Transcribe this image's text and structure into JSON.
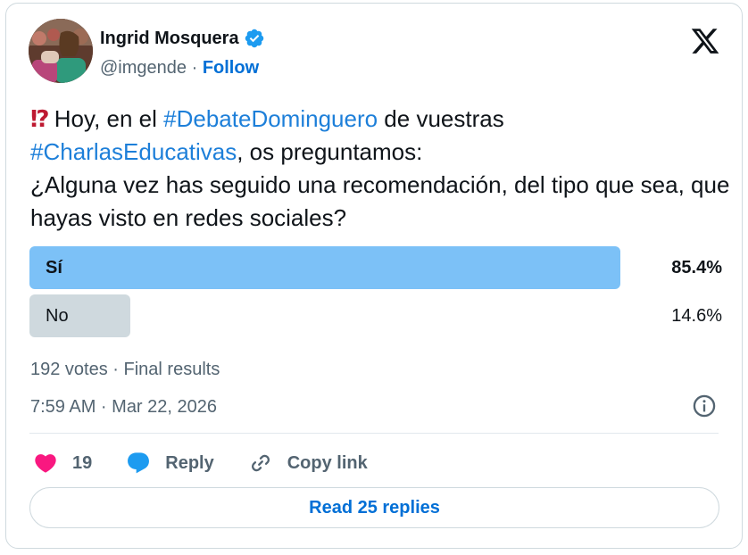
{
  "author": {
    "name": "Ingrid Mosquera",
    "handle": "@imgende",
    "separator": " · ",
    "follow_label": "Follow"
  },
  "tweet": {
    "emoji": "⁉",
    "text_1": " Hoy, en el ",
    "hashtag_1": "#DebateDominguero",
    "text_2": " de vuestras ",
    "hashtag_2": "#CharlasEducativas",
    "text_3": ", os preguntamos:",
    "text_4": "¿Alguna vez has seguido una recomendación, del tipo que sea, que hayas visto en redes sociales?"
  },
  "poll": {
    "options": [
      {
        "label": "Sí",
        "percent_label": "85.4%",
        "percent": 85.4,
        "winner": true
      },
      {
        "label": "No",
        "percent_label": "14.6%",
        "percent": 14.6,
        "winner": false
      }
    ],
    "summary": "192 votes · Final results"
  },
  "timestamp": "7:59 AM · Mar 22, 2026",
  "actions": {
    "like_count": "19",
    "reply_label": "Reply",
    "copy_link_label": "Copy link"
  },
  "read_replies_label": "Read 25 replies",
  "colors": {
    "accent": "#1d9bf0",
    "link": "#006fd6",
    "poll_winner": "#7cc1f7",
    "poll_loser": "#cfd9de",
    "like": "#f91880"
  },
  "icons": [
    "verified-badge-icon",
    "x-logo-icon",
    "info-icon",
    "heart-icon",
    "reply-bubble-icon",
    "link-icon"
  ]
}
